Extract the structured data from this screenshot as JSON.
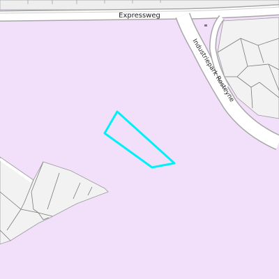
{
  "map": {
    "colors": {
      "industrial_area": "#f2e0fb",
      "parcel_fill": "#f2f2f2",
      "parcel_outline": "#9a9a9a",
      "road_fill": "#ffffff",
      "road_casing": "#a8a8a8",
      "highlight": "#00f0f8"
    },
    "labels": {
      "top_road": "Expressweg",
      "side_road": "Industriepark Rosteyne"
    },
    "highlight_feature": "selected-parcel"
  }
}
